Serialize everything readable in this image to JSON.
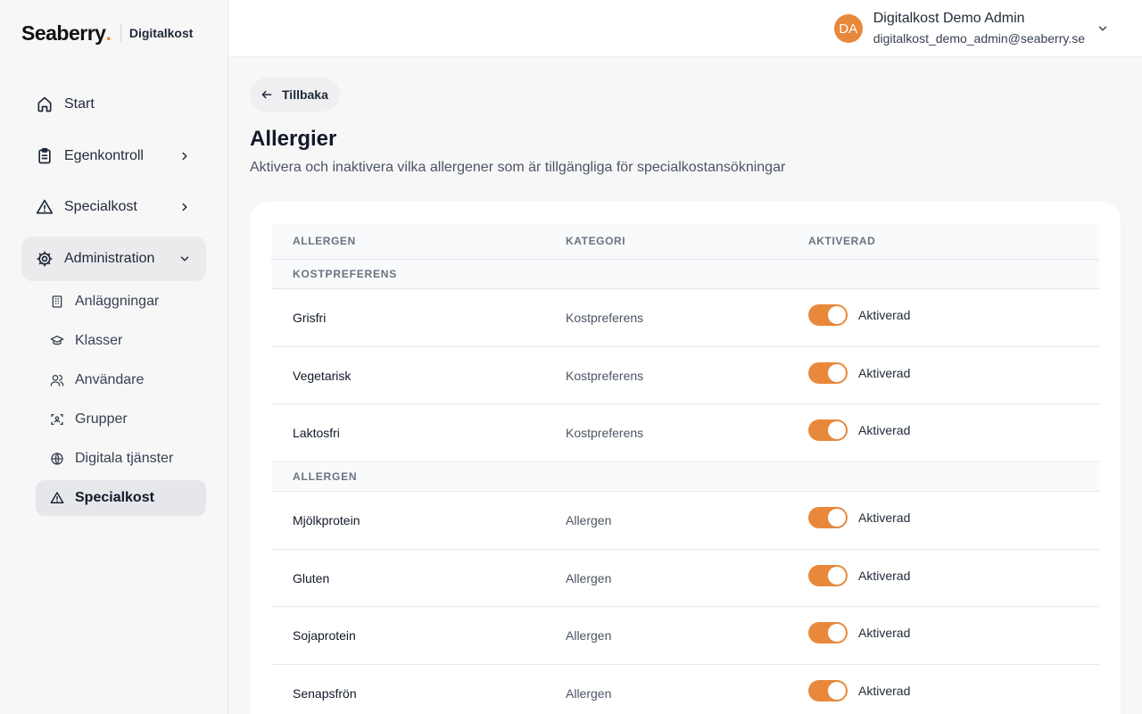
{
  "brand": {
    "name": "Seaberry",
    "dot": ".",
    "product": "Digitalkost"
  },
  "colors": {
    "accent": "#e8883a"
  },
  "nav": {
    "items": [
      {
        "label": "Start",
        "icon": "home-icon"
      },
      {
        "label": "Egenkontroll",
        "icon": "clipboard-icon"
      },
      {
        "label": "Specialkost",
        "icon": "warning-icon"
      },
      {
        "label": "Administration",
        "icon": "gear-icon"
      }
    ],
    "sub": [
      {
        "label": "Anläggningar",
        "icon": "building-icon"
      },
      {
        "label": "Klasser",
        "icon": "graduation-cap-icon"
      },
      {
        "label": "Användare",
        "icon": "users-icon"
      },
      {
        "label": "Grupper",
        "icon": "group-scan-icon"
      },
      {
        "label": "Digitala tjänster",
        "icon": "globe-icon"
      },
      {
        "label": "Specialkost",
        "icon": "warning-icon"
      }
    ]
  },
  "user": {
    "initials": "DA",
    "name": "Digitalkost Demo Admin",
    "email": "digitalkost_demo_admin@seaberry.se"
  },
  "page": {
    "back": "Tillbaka",
    "title": "Allergier",
    "description": "Aktivera och inaktivera vilka allergener som är tillgängliga för specialkostansökningar"
  },
  "table": {
    "headers": [
      "ALLERGEN",
      "KATEGORI",
      "AKTIVERAD"
    ],
    "groups": [
      {
        "label": "KOSTPREFERENS",
        "rows": [
          {
            "name": "Grisfri",
            "category": "Kostpreferens",
            "status": "Aktiverad",
            "enabled": true
          },
          {
            "name": "Vegetarisk",
            "category": "Kostpreferens",
            "status": "Aktiverad",
            "enabled": true
          },
          {
            "name": "Laktosfri",
            "category": "Kostpreferens",
            "status": "Aktiverad",
            "enabled": true
          }
        ]
      },
      {
        "label": "ALLERGEN",
        "rows": [
          {
            "name": "Mjölkprotein",
            "category": "Allergen",
            "status": "Aktiverad",
            "enabled": true
          },
          {
            "name": "Gluten",
            "category": "Allergen",
            "status": "Aktiverad",
            "enabled": true
          },
          {
            "name": "Sojaprotein",
            "category": "Allergen",
            "status": "Aktiverad",
            "enabled": true
          },
          {
            "name": "Senapsfrön",
            "category": "Allergen",
            "status": "Aktiverad",
            "enabled": true
          }
        ]
      }
    ]
  }
}
